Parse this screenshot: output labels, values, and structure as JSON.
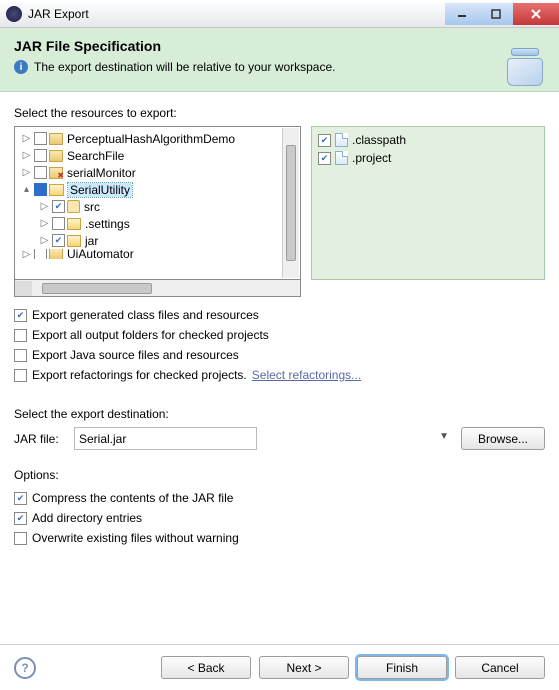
{
  "window": {
    "title": "JAR Export"
  },
  "banner": {
    "heading": "JAR File Specification",
    "subtitle": "The export destination will be relative to your workspace."
  },
  "resources_label": "Select the resources to export:",
  "tree": {
    "items": [
      {
        "label": "PerceptualHashAlgorithmDemo",
        "expand": "▷",
        "checked": false,
        "icon": "proj",
        "indent": 0
      },
      {
        "label": "SearchFile",
        "expand": "▷",
        "checked": false,
        "icon": "proj",
        "indent": 0
      },
      {
        "label": "serialMonitor",
        "expand": "▷",
        "checked": false,
        "icon": "proj-x",
        "indent": 0
      },
      {
        "label": "SerialUtility",
        "expand": "▴",
        "checked": "filled",
        "icon": "proj-open",
        "indent": 0,
        "selected": true
      },
      {
        "label": "src",
        "expand": "▷",
        "checked": true,
        "icon": "pkg",
        "indent": 1
      },
      {
        "label": ".settings",
        "expand": "▷",
        "checked": false,
        "icon": "folder",
        "indent": 1
      },
      {
        "label": "jar",
        "expand": "▷",
        "checked": true,
        "icon": "folder",
        "indent": 1
      },
      {
        "label": "UiAutomator",
        "expand": "▷",
        "checked": false,
        "icon": "proj",
        "indent": 0,
        "cutoff": true
      }
    ]
  },
  "right_files": [
    {
      "label": ".classpath",
      "checked": true
    },
    {
      "label": ".project",
      "checked": true
    }
  ],
  "export_options": [
    {
      "label": "Export generated class files and resources",
      "checked": true
    },
    {
      "label": "Export all output folders for checked projects",
      "checked": false
    },
    {
      "label": "Export Java source files and resources",
      "checked": false
    }
  ],
  "refactor_opt": {
    "label": "Export refactorings for checked projects.",
    "link": "Select refactorings...",
    "checked": false
  },
  "dest_label": "Select the export destination:",
  "jar_label": "JAR file:",
  "jar_value": "Serial.jar",
  "browse_btn": "Browse...",
  "options_label": "Options:",
  "options": [
    {
      "label": "Compress the contents of the JAR file",
      "checked": true
    },
    {
      "label": "Add directory entries",
      "checked": true
    },
    {
      "label": "Overwrite existing files without warning",
      "checked": false
    }
  ],
  "buttons": {
    "back": "< Back",
    "next": "Next >",
    "finish": "Finish",
    "cancel": "Cancel"
  }
}
